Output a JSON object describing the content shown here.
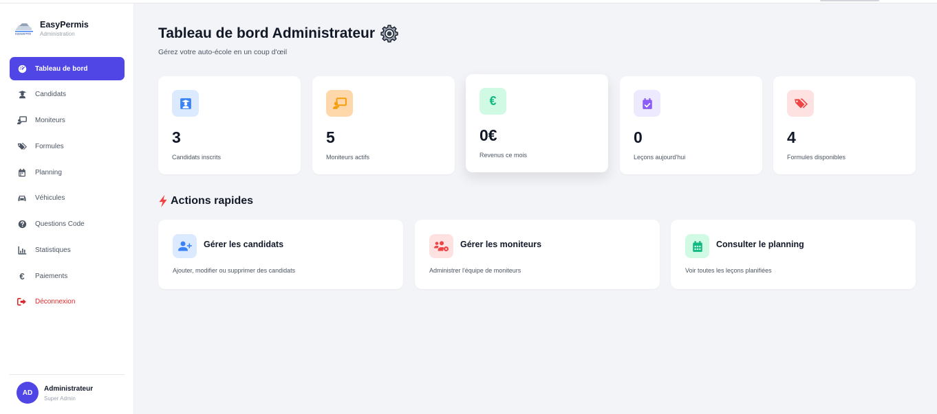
{
  "brand": {
    "name": "EasyPermis",
    "subtitle": "Administration",
    "logo_text": "easypermis"
  },
  "sidebar": {
    "items": [
      {
        "label": "Tableau de bord",
        "icon": "dashboard-gauge-icon",
        "active": true
      },
      {
        "label": "Candidats",
        "icon": "graduate-icon"
      },
      {
        "label": "Moniteurs",
        "icon": "chalkboard-teacher-icon"
      },
      {
        "label": "Formules",
        "icon": "tags-icon"
      },
      {
        "label": "Planning",
        "icon": "calendar-icon"
      },
      {
        "label": "Véhicules",
        "icon": "car-icon"
      },
      {
        "label": "Questions Code",
        "icon": "question-circle-icon"
      },
      {
        "label": "Statistiques",
        "icon": "chart-icon"
      },
      {
        "label": "Paiements",
        "icon": "euro-icon"
      },
      {
        "label": "Déconnexion",
        "icon": "logout-icon",
        "danger": true
      }
    ]
  },
  "user": {
    "initials": "AD",
    "name": "Administrateur",
    "role": "Super Admin"
  },
  "header": {
    "title": "Tableau de bord Administrateur",
    "subtitle": "Gérez votre auto-école en un coup d'œil"
  },
  "stats": [
    {
      "value": "3",
      "label": "Candidats inscrits",
      "icon": "graduate-icon",
      "bg": "#dbeafe",
      "fg": "#3b82f6"
    },
    {
      "value": "5",
      "label": "Moniteurs actifs",
      "icon": "chalkboard-teacher-icon",
      "bg": "#fed7aa",
      "fg": "#f59e0b"
    },
    {
      "value": "0€",
      "label": "Revenus ce mois",
      "icon": "euro-icon",
      "bg": "#d1fae5",
      "fg": "#10b981"
    },
    {
      "value": "0",
      "label": "Leçons aujourd'hui",
      "icon": "calendar-check-icon",
      "bg": "#ede9fe",
      "fg": "#8b5cf6"
    },
    {
      "value": "4",
      "label": "Formules disponibles",
      "icon": "tags-icon",
      "bg": "#fee2e2",
      "fg": "#ef4444"
    }
  ],
  "quick_actions": {
    "title": "Actions rapides",
    "items": [
      {
        "title": "Gérer les candidats",
        "description": "Ajouter, modifier ou supprimer des candidats",
        "icon": "user-plus-icon",
        "bg": "#dbeafe",
        "fg": "#3b82f6"
      },
      {
        "title": "Gérer les moniteurs",
        "description": "Administrer l'équipe de moniteurs",
        "icon": "users-cog-icon",
        "bg": "#fee2e2",
        "fg": "#ef4444"
      },
      {
        "title": "Consulter le planning",
        "description": "Voir toutes les leçons planifiées",
        "icon": "calendar-grid-icon",
        "bg": "#d1fae5",
        "fg": "#10b981"
      }
    ]
  },
  "colors": {
    "accent": "#4f46e5",
    "danger": "#dc2626",
    "background": "#f3f4f7"
  }
}
